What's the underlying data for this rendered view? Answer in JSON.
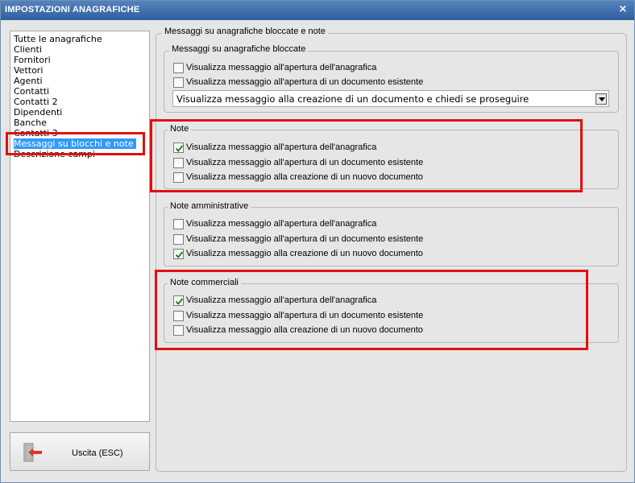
{
  "window": {
    "title": "IMPOSTAZIONI ANAGRAFICHE",
    "close": "×"
  },
  "sidebar": {
    "items": [
      {
        "label": "Tutte le anagrafiche"
      },
      {
        "label": "Clienti"
      },
      {
        "label": "Fornitori"
      },
      {
        "label": "Vettori"
      },
      {
        "label": "Agenti"
      },
      {
        "label": "Contatti"
      },
      {
        "label": "Contatti 2"
      },
      {
        "label": "Dipendenti"
      },
      {
        "label": "Banche"
      },
      {
        "label": "Contatti 3"
      },
      {
        "label": "Messaggi su blocchi e note",
        "selected": true
      },
      {
        "label": "Descrizione campi"
      }
    ]
  },
  "exit_button": {
    "label": "Uscita (ESC)",
    "icon": "exit-door-icon"
  },
  "main": {
    "title": "Messaggi su anagrafiche bloccate e note",
    "groups": [
      {
        "title": "Messaggi su anagrafiche bloccate",
        "options": [
          {
            "label": "Visualizza messaggio all'apertura dell'anagrafica",
            "checked": false
          },
          {
            "label": "Visualizza messaggio all'apertura di un documento esistente",
            "checked": false
          }
        ],
        "combo": {
          "value": "Visualizza messaggio alla creazione di un documento e chiedi se proseguire"
        }
      },
      {
        "title": "Note",
        "options": [
          {
            "label": "Visualizza messaggio all'apertura dell'anagrafica",
            "checked": true
          },
          {
            "label": "Visualizza messaggio all'apertura di un documento esistente",
            "checked": false
          },
          {
            "label": "Visualizza messaggio alla creazione di un nuovo documento",
            "checked": false
          }
        ]
      },
      {
        "title": "Note amministrative",
        "options": [
          {
            "label": "Visualizza messaggio all'apertura dell'anagrafica",
            "checked": false
          },
          {
            "label": "Visualizza messaggio all'apertura di un documento esistente",
            "checked": false
          },
          {
            "label": "Visualizza messaggio alla creazione di un nuovo documento",
            "checked": true
          }
        ]
      },
      {
        "title": "Note commerciali",
        "options": [
          {
            "label": "Visualizza messaggio all'apertura dell'anagrafica",
            "checked": true
          },
          {
            "label": "Visualizza messaggio all'apertura di un documento esistente",
            "checked": false
          },
          {
            "label": "Visualizza messaggio alla creazione di un nuovo documento",
            "checked": false
          }
        ]
      }
    ]
  },
  "colors": {
    "highlight": "#e01010",
    "title_bar": "#3a6aa8",
    "selection": "#3399ff"
  }
}
